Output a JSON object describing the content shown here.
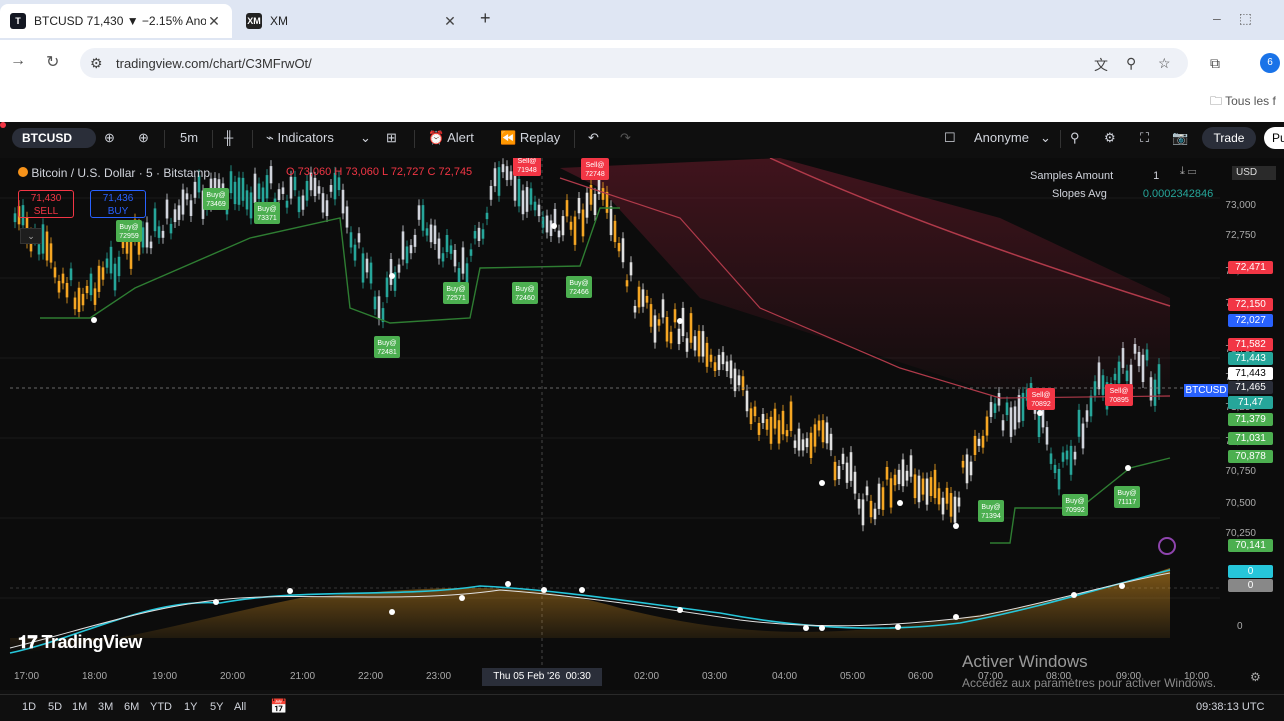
{
  "browser": {
    "tabs": [
      {
        "title": "BTCUSD 71,430 ▼ −2.15% Ano",
        "icon": "T",
        "active": true
      },
      {
        "title": "XM",
        "icon": "XM",
        "active": false
      }
    ],
    "url": "tradingview.com/chart/C3MFrwOt/",
    "bookmark_folder": "Tous les f",
    "profile_initial": "6"
  },
  "toolbar": {
    "symbol": "BTCUSD",
    "interval": "5m",
    "indicators_label": "Indicators",
    "alert_label": "Alert",
    "replay_label": "Replay",
    "account_label": "Anonyme",
    "trade_label": "Trade",
    "publish_label": "Pu"
  },
  "legend": {
    "title": "Bitcoin / U.S. Dollar · 5 · Bitstamp",
    "o": "O 73,060",
    "h": "H 73,060",
    "l": "L 72,727",
    "c": "C 72,745",
    "sell_price": "71,430",
    "sell_label": "SELL",
    "buy_price": "71,436",
    "buy_label": "BUY"
  },
  "indicator_panel": {
    "row1_label": "Samples Amount",
    "row1_value": "1",
    "row2_label": "Slopes Avg",
    "row2_value": "0.0002342846",
    "currency": "USD"
  },
  "price_axis": {
    "labels": [
      "73,000",
      "72,750",
      "72,500",
      "72,250",
      "71,750",
      "71,500",
      "71,250",
      "71,000",
      "70,750",
      "70,500",
      "70,250"
    ],
    "tags": [
      {
        "text": "72,471",
        "color": "#f23645"
      },
      {
        "text": "72,150",
        "color": "#f23645"
      },
      {
        "text": "72,027",
        "color": "#2962ff"
      },
      {
        "text": "71,582",
        "color": "#f23645"
      },
      {
        "text": "71,443",
        "color": "#26a69a"
      },
      {
        "text": "71,443",
        "color": "#ffffff"
      },
      {
        "text": "71,465",
        "color": "#2a2e39"
      },
      {
        "text": "71,47",
        "color": "#26a69a"
      },
      {
        "text": "71,379",
        "color": "#4caf50"
      },
      {
        "text": "71,031",
        "color": "#4caf50"
      },
      {
        "text": "70,878",
        "color": "#4caf50"
      },
      {
        "text": "70,141",
        "color": "#4caf50"
      },
      {
        "text": "0",
        "color": "#26c6da"
      },
      {
        "text": "0",
        "color": "#888888"
      }
    ],
    "symbol_tag": "BTCUSD",
    "zero_label": "0"
  },
  "time_axis": {
    "labels": [
      "17:00",
      "18:00",
      "19:00",
      "20:00",
      "21:00",
      "22:00",
      "23:00",
      "02:00",
      "03:00",
      "04:00",
      "05:00",
      "06:00",
      "07:00",
      "08:00",
      "09:00",
      "10:00"
    ],
    "crosshair_date": "Thu 05 Feb '26",
    "crosshair_time": "00:30"
  },
  "signals": {
    "buy": [
      "Buy@ 73469",
      "Buy@ 73371",
      "Buy@ 72959",
      "Buy@ 72571",
      "Buy@ 72460",
      "Buy@ 72466",
      "Buy@ 72481",
      "Buy@ 71394",
      "Buy@ 70992",
      "Buy@ 71117"
    ],
    "sell": [
      "Sell@ 71948",
      "Sell@ 72748",
      "Sell@ 70892",
      "Sell@ 70895"
    ]
  },
  "bottombar": {
    "ranges": [
      "1D",
      "5D",
      "1M",
      "3M",
      "6M",
      "YTD",
      "1Y",
      "5Y",
      "All"
    ],
    "clock": "09:38:13 UTC"
  },
  "watermark": {
    "brand": "TradingView",
    "activate_title": "Activer Windows",
    "activate_sub": "Accédez aux paramètres pour activer Windows."
  },
  "colors": {
    "up": "#26a69a",
    "down": "#ef5350",
    "accent": "#2962ff",
    "buy_badge": "#4caf50",
    "sell_badge": "#f23645"
  }
}
